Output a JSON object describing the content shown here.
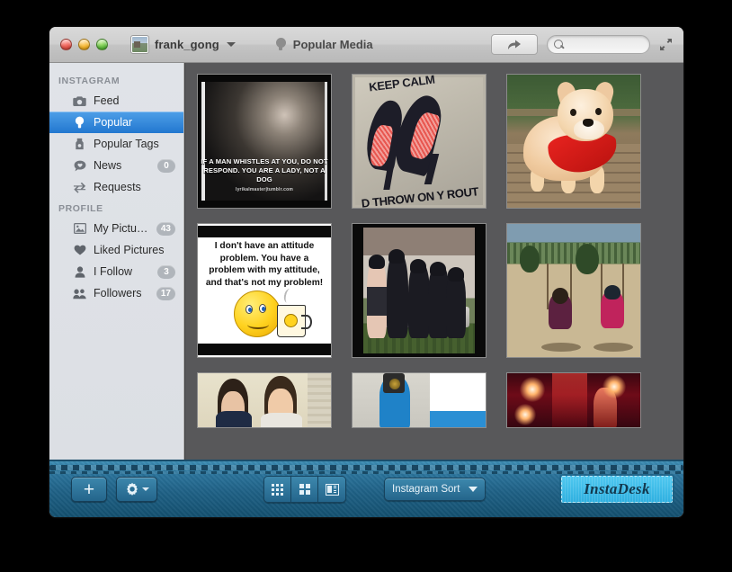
{
  "window": {
    "traffic_lights": [
      "close",
      "minimize",
      "zoom"
    ],
    "account_name": "frank_gong",
    "document_title": "Popular Media",
    "document_icon": "lightbulb-icon",
    "share_icon": "share-arrow-icon",
    "fullscreen_icon": "fullscreen-arrows-icon"
  },
  "search": {
    "value": "",
    "placeholder": "",
    "icon": "search-icon"
  },
  "sidebar": {
    "sections": [
      {
        "title": "INSTAGRAM",
        "items": [
          {
            "label": "Feed",
            "icon": "camera-icon",
            "badge": "",
            "active": false
          },
          {
            "label": "Popular",
            "icon": "lightbulb-icon",
            "badge": "",
            "active": true
          },
          {
            "label": "Popular Tags",
            "icon": "tag-icon",
            "badge": "",
            "active": false
          },
          {
            "label": "News",
            "icon": "speech-bubble-heart-icon",
            "badge": "0",
            "active": false
          },
          {
            "label": "Requests",
            "icon": "arrows-exchange-icon",
            "badge": "",
            "active": false
          }
        ]
      },
      {
        "title": "PROFILE",
        "items": [
          {
            "label": "My Pictu…",
            "icon": "picture-icon",
            "badge": "43",
            "active": false
          },
          {
            "label": "Liked Pictures",
            "icon": "heart-icon",
            "badge": "",
            "active": false
          },
          {
            "label": "I Follow",
            "icon": "person-icon",
            "badge": "3",
            "active": false
          },
          {
            "label": "Followers",
            "icon": "people-icon",
            "badge": "17",
            "active": false
          }
        ]
      }
    ]
  },
  "media_grid": {
    "tiles": [
      {
        "name": "quote-whistles-photo",
        "kind": "black-white-quote-photo",
        "caption": "IF A MAN WHISTLES AT YOU, DO NOT RESPOND. YOU ARE A LADY, NOT A DOG",
        "source": "lyrikalmaster|tumblr.com"
      },
      {
        "name": "keep-calm-heels-tshirt",
        "kind": "photo",
        "text_top": "KEEP CALM",
        "text_bottom": "D THROW ON Y ROUT"
      },
      {
        "name": "shiba-puppy-red-scarf",
        "kind": "photo"
      },
      {
        "name": "quote-attitude-problem",
        "kind": "quote-image",
        "caption": "I don't have an attitude problem. You have a problem with my attitude, and that's not my problem!"
      },
      {
        "name": "friends-group-bench",
        "kind": "photo"
      },
      {
        "name": "girls-on-swings",
        "kind": "photo"
      },
      {
        "name": "two-young-men-selfie",
        "kind": "photo"
      },
      {
        "name": "mirror-selfie-camera",
        "kind": "photo"
      },
      {
        "name": "red-stage-lights-concert",
        "kind": "photo"
      }
    ]
  },
  "bottom_bar": {
    "add_label": "+",
    "add_icon": "plus-icon",
    "gear_icon": "gear-icon",
    "view_modes": [
      {
        "name": "small-grid",
        "icon": "grid-small-icon",
        "selected": true
      },
      {
        "name": "large-grid",
        "icon": "grid-large-icon",
        "selected": false
      },
      {
        "name": "list-view",
        "icon": "list-icon",
        "selected": false
      }
    ],
    "sort_label": "Instagram Sort",
    "brand": "InstaDesk"
  },
  "colors": {
    "accent_blue": "#2277cf",
    "sidebar_bg": "#e0e3e8",
    "content_bg": "#58585a",
    "denim": "#1f6186",
    "brand_patch": "#2fb0e0"
  }
}
